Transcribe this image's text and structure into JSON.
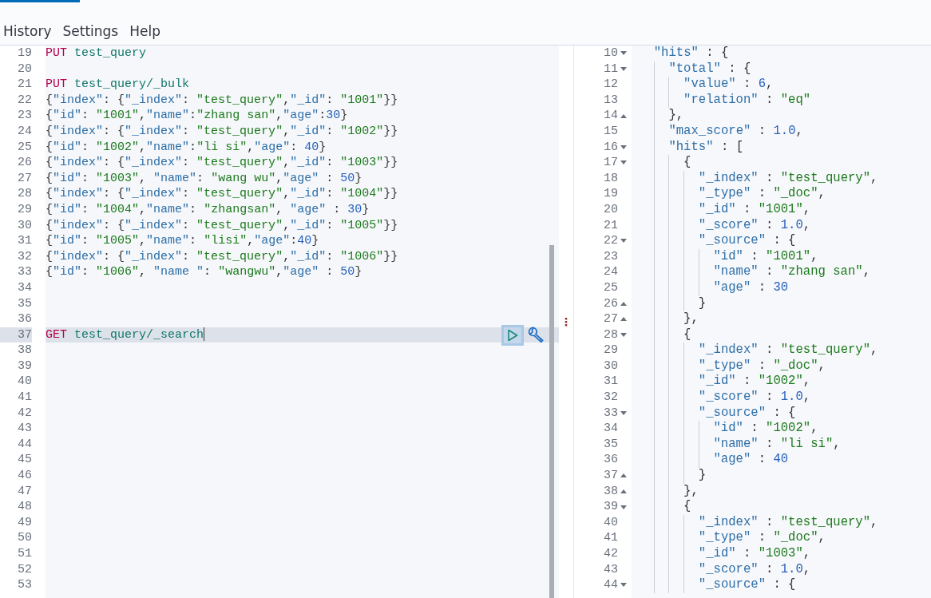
{
  "resizer": {
    "handle": "⋮"
  },
  "menu": [
    {
      "label": "History"
    },
    {
      "label": "Settings"
    },
    {
      "label": "Help"
    }
  ],
  "request_editor": {
    "lines": [
      {
        "number": "19",
        "kind": "request",
        "method": "PUT",
        "path": "test_query",
        "active": false
      },
      {
        "number": "20",
        "kind": "blank",
        "active": false
      },
      {
        "number": "21",
        "kind": "request",
        "method": "PUT",
        "path": "test_query/_bulk",
        "active": false
      },
      {
        "number": "22",
        "kind": "body",
        "text": "{\"index\": {\"_index\": \"test_query\",\"_id\": \"1001\"}}",
        "active": false
      },
      {
        "number": "23",
        "kind": "body",
        "text": "{\"id\": \"1001\",\"name\":\"zhang san\",\"age\":30}",
        "active": false
      },
      {
        "number": "24",
        "kind": "body",
        "text": "{\"index\": {\"_index\": \"test_query\",\"_id\": \"1002\"}}",
        "active": false
      },
      {
        "number": "25",
        "kind": "body",
        "text": "{\"id\": \"1002\",\"name\":\"li si\",\"age\": 40}",
        "active": false
      },
      {
        "number": "26",
        "kind": "body",
        "text": "{\"index\": {\"_index\": \"test_query\",\"_id\": \"1003\"}}",
        "active": false
      },
      {
        "number": "27",
        "kind": "body",
        "text": "{\"id\": \"1003\", \"name\": \"wang wu\",\"age\" : 50}",
        "active": false
      },
      {
        "number": "28",
        "kind": "body",
        "text": "{\"index\": {\"_index\": \"test_query\",\"_id\": \"1004\"}}",
        "active": false
      },
      {
        "number": "29",
        "kind": "body",
        "text": "{\"id\": \"1004\",\"name\": \"zhangsan\", \"age\" : 30}",
        "active": false
      },
      {
        "number": "30",
        "kind": "body",
        "text": "{\"index\": {\"_index\": \"test_query\",\"_id\": \"1005\"}}",
        "active": false
      },
      {
        "number": "31",
        "kind": "body",
        "text": "{\"id\": \"1005\",\"name\": \"lisi\",\"age\":40}",
        "active": false
      },
      {
        "number": "32",
        "kind": "body",
        "text": "{\"index\": {\"_index\": \"test_query\",\"_id\": \"1006\"}}",
        "active": false
      },
      {
        "number": "33",
        "kind": "body",
        "text": "{\"id\": \"1006\", \"name \": \"wangwu\",\"age\" : 50}",
        "active": false
      },
      {
        "number": "34",
        "kind": "blank",
        "active": false
      },
      {
        "number": "35",
        "kind": "blank",
        "active": false
      },
      {
        "number": "36",
        "kind": "blank",
        "active": false
      },
      {
        "number": "37",
        "kind": "request",
        "method": "GET",
        "path": "test_query/_search",
        "active": true
      },
      {
        "number": "38",
        "kind": "blank",
        "active": false
      },
      {
        "number": "39",
        "kind": "blank",
        "active": false
      },
      {
        "number": "40",
        "kind": "blank",
        "active": false
      },
      {
        "number": "41",
        "kind": "blank",
        "active": false
      },
      {
        "number": "42",
        "kind": "blank",
        "active": false
      },
      {
        "number": "43",
        "kind": "blank",
        "active": false
      },
      {
        "number": "44",
        "kind": "blank",
        "active": false
      },
      {
        "number": "45",
        "kind": "blank",
        "active": false
      },
      {
        "number": "46",
        "kind": "blank",
        "active": false
      },
      {
        "number": "47",
        "kind": "blank",
        "active": false
      },
      {
        "number": "48",
        "kind": "blank",
        "active": false
      },
      {
        "number": "49",
        "kind": "blank",
        "active": false
      },
      {
        "number": "50",
        "kind": "blank",
        "active": false
      },
      {
        "number": "51",
        "kind": "blank",
        "active": false
      },
      {
        "number": "52",
        "kind": "blank",
        "active": false
      },
      {
        "number": "53",
        "kind": "blank",
        "active": false
      }
    ]
  },
  "response_viewer": {
    "lines": [
      {
        "number": "10",
        "kind": "fold-start",
        "text": "  \"hits\" : {"
      },
      {
        "number": "11",
        "kind": "fold-start",
        "text": "    \"total\" : {"
      },
      {
        "number": "12",
        "kind": "plain",
        "text": "      \"value\" : 6,"
      },
      {
        "number": "13",
        "kind": "plain",
        "text": "      \"relation\" : \"eq\""
      },
      {
        "number": "14",
        "kind": "fold-end",
        "text": "    },"
      },
      {
        "number": "15",
        "kind": "plain",
        "text": "    \"max_score\" : 1.0,"
      },
      {
        "number": "16",
        "kind": "fold-start",
        "text": "    \"hits\" : ["
      },
      {
        "number": "17",
        "kind": "fold-start",
        "text": "      {"
      },
      {
        "number": "18",
        "kind": "plain",
        "text": "        \"_index\" : \"test_query\","
      },
      {
        "number": "19",
        "kind": "plain",
        "text": "        \"_type\" : \"_doc\","
      },
      {
        "number": "20",
        "kind": "plain",
        "text": "        \"_id\" : \"1001\","
      },
      {
        "number": "21",
        "kind": "plain",
        "text": "        \"_score\" : 1.0,"
      },
      {
        "number": "22",
        "kind": "fold-start",
        "text": "        \"_source\" : {"
      },
      {
        "number": "23",
        "kind": "plain",
        "text": "          \"id\" : \"1001\","
      },
      {
        "number": "24",
        "kind": "plain",
        "text": "          \"name\" : \"zhang san\","
      },
      {
        "number": "25",
        "kind": "plain",
        "text": "          \"age\" : 30"
      },
      {
        "number": "26",
        "kind": "fold-end",
        "text": "        }"
      },
      {
        "number": "27",
        "kind": "fold-end",
        "text": "      },"
      },
      {
        "number": "28",
        "kind": "fold-start",
        "text": "      {"
      },
      {
        "number": "29",
        "kind": "plain",
        "text": "        \"_index\" : \"test_query\","
      },
      {
        "number": "30",
        "kind": "plain",
        "text": "        \"_type\" : \"_doc\","
      },
      {
        "number": "31",
        "kind": "plain",
        "text": "        \"_id\" : \"1002\","
      },
      {
        "number": "32",
        "kind": "plain",
        "text": "        \"_score\" : 1.0,"
      },
      {
        "number": "33",
        "kind": "fold-start",
        "text": "        \"_source\" : {"
      },
      {
        "number": "34",
        "kind": "plain",
        "text": "          \"id\" : \"1002\","
      },
      {
        "number": "35",
        "kind": "plain",
        "text": "          \"name\" : \"li si\","
      },
      {
        "number": "36",
        "kind": "plain",
        "text": "          \"age\" : 40"
      },
      {
        "number": "37",
        "kind": "fold-end",
        "text": "        }"
      },
      {
        "number": "38",
        "kind": "fold-end",
        "text": "      },"
      },
      {
        "number": "39",
        "kind": "fold-start",
        "text": "      {"
      },
      {
        "number": "40",
        "kind": "plain",
        "text": "        \"_index\" : \"test_query\","
      },
      {
        "number": "41",
        "kind": "plain",
        "text": "        \"_type\" : \"_doc\","
      },
      {
        "number": "42",
        "kind": "plain",
        "text": "        \"_id\" : \"1003\","
      },
      {
        "number": "43",
        "kind": "plain",
        "text": "        \"_score\" : 1.0,"
      },
      {
        "number": "44",
        "kind": "fold-start",
        "text": "        \"_source\" : {"
      }
    ]
  }
}
